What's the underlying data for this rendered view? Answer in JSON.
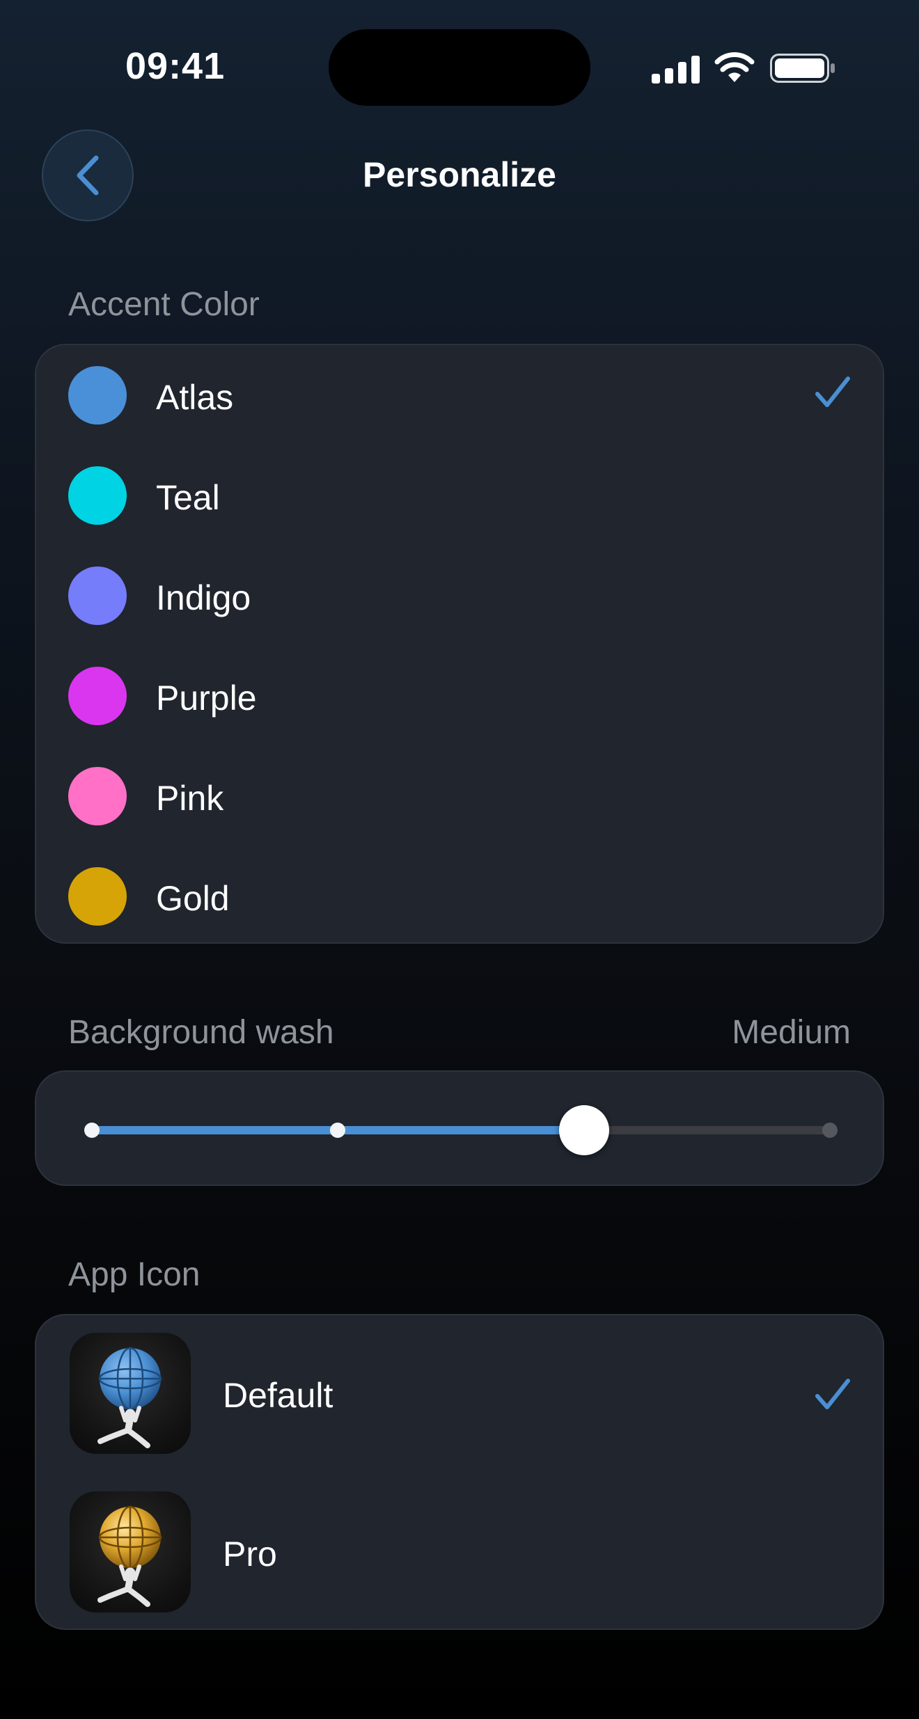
{
  "status_bar": {
    "time": "09:41"
  },
  "header": {
    "title": "Personalize"
  },
  "accent_section": {
    "label": "Accent Color",
    "colors": [
      {
        "name": "Atlas",
        "color": "#4a90d9",
        "selected": true
      },
      {
        "name": "Teal",
        "color": "#00d3e3",
        "selected": false
      },
      {
        "name": "Indigo",
        "color": "#767dfb",
        "selected": false
      },
      {
        "name": "Purple",
        "color": "#db36ef",
        "selected": false
      },
      {
        "name": "Pink",
        "color": "#ff70c6",
        "selected": false
      },
      {
        "name": "Gold",
        "color": "#d6a406",
        "selected": false
      }
    ]
  },
  "background_wash": {
    "label": "Background wash",
    "value_label": "Medium",
    "levels": 4,
    "selected_index": 2
  },
  "app_icon_section": {
    "label": "App Icon",
    "icons": [
      {
        "name": "Default",
        "globe": "blue",
        "selected": true
      },
      {
        "name": "Pro",
        "globe": "gold",
        "selected": false
      }
    ]
  },
  "colors": {
    "accent": "#4a8fd3",
    "card_bg": "#20252e",
    "secondary_text": "#8f949b"
  }
}
